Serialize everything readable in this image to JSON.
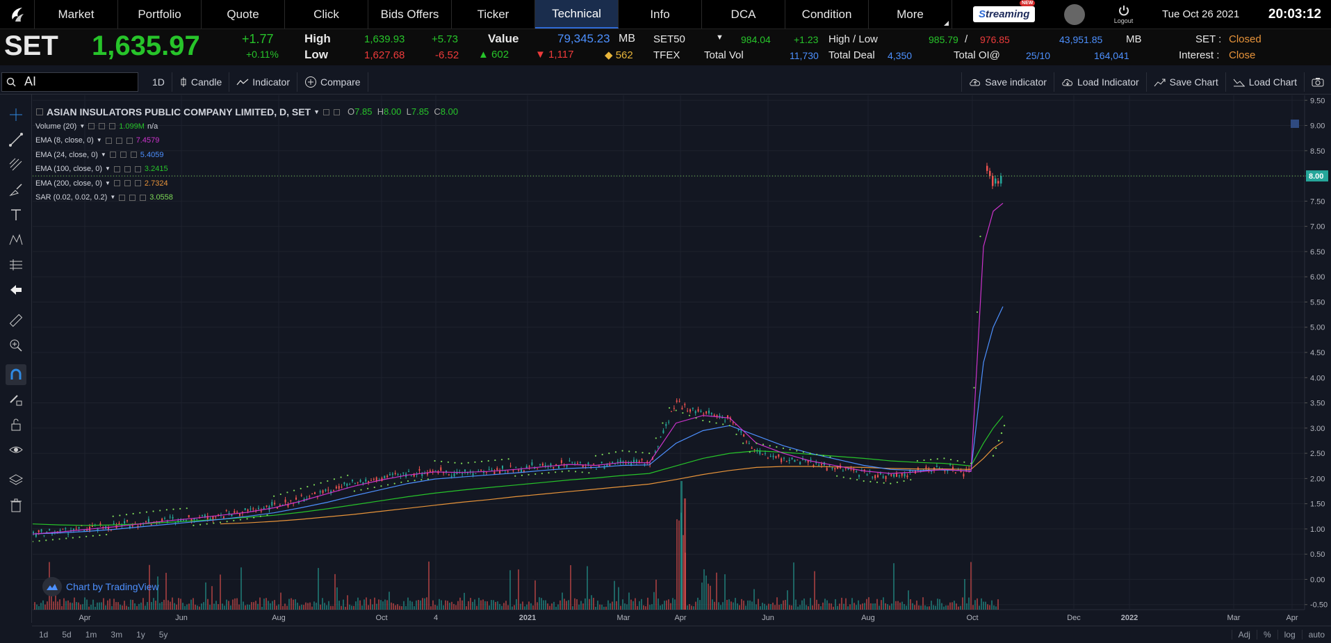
{
  "nav": {
    "tabs": [
      "Market",
      "Portfolio",
      "Quote",
      "Click",
      "Bids Offers",
      "Ticker",
      "Technical",
      "Info",
      "DCA",
      "Condition",
      "More"
    ],
    "active": "Technical",
    "brand": "treaming",
    "brand_badge": "NEW",
    "logout_label": "Logout",
    "date": "Tue Oct 26 2021",
    "time": "20:03:12"
  },
  "ticker": {
    "symbol": "SET",
    "price": "1,635.97",
    "change": "+1.77",
    "change_pct": "+0.11%",
    "high_label": "High",
    "high": "1,639.93",
    "high_chg": "+5.73",
    "low_label": "Low",
    "low": "1,627.68",
    "low_chg": "-6.52",
    "value_label": "Value",
    "value": "79,345.23",
    "value_unit": "MB",
    "up_count": "602",
    "down_count": "1,117",
    "unch_count": "562",
    "set50_label": "SET50",
    "set50": "984.04",
    "set50_chg": "+1.23",
    "hl_label": "High / Low",
    "set50_high": "985.79",
    "hl_sep": "/",
    "set50_low": "976.85",
    "set50_value": "43,951.85",
    "set50_unit": "MB",
    "set_status_label": "SET :",
    "set_status": "Closed",
    "tfex_label": "TFEX",
    "totalvol_label": "Total Vol",
    "totalvol": "11,730",
    "totaldeal_label": "Total Deal",
    "totaldeal": "4,350",
    "totaloi_label": "Total OI@",
    "totaloi_date": "25/10",
    "totaloi": "164,041",
    "interest_label": "Interest :",
    "interest": "Close"
  },
  "toolbar": {
    "search_value": "AI",
    "interval": "1D",
    "candle": "Candle",
    "indicator": "Indicator",
    "compare": "Compare",
    "save_indicator": "Save indicator",
    "load_indicator": "Load Indicator",
    "save_chart": "Save Chart",
    "load_chart": "Load Chart"
  },
  "legend": {
    "title": "ASIAN INSULATORS PUBLIC COMPANY LIMITED, D, SET",
    "o_label": "O",
    "o": "7.85",
    "h_label": "H",
    "h": "8.00",
    "l_label": "L",
    "l": "7.85",
    "c_label": "C",
    "c": "8.00",
    "volume_label": "Volume (20)",
    "volume_value": "1.099M",
    "volume_extra": "n/a",
    "ema8_label": "EMA (8, close, 0)",
    "ema8": "7.4579",
    "ema24_label": "EMA (24, close, 0)",
    "ema24": "5.4059",
    "ema100_label": "EMA (100, close, 0)",
    "ema100": "3.2415",
    "ema200_label": "EMA (200, close, 0)",
    "ema200": "2.7324",
    "sar_label": "SAR (0.02, 0.02, 0.2)",
    "sar": "3.0558"
  },
  "colors": {
    "ema8": "#cc33cc",
    "ema24": "#4d90fe",
    "ema100": "#27c42a",
    "ema200": "#e8943a",
    "sar": "#7ed957",
    "up": "#26a69a",
    "down": "#ef5350"
  },
  "chart_data": {
    "type": "candlestick",
    "y_ticks": [
      "9.50",
      "9.00",
      "8.50",
      "8.00",
      "7.50",
      "7.00",
      "6.50",
      "6.00",
      "5.50",
      "5.00",
      "4.50",
      "4.00",
      "3.50",
      "3.00",
      "2.50",
      "2.00",
      "1.50",
      "1.00",
      "0.50",
      "0.00",
      "-0.50"
    ],
    "ylim": [
      -0.6,
      9.6
    ],
    "x_ticks": [
      "Apr",
      "Jun",
      "Aug",
      "Oct",
      "4",
      "2021",
      "Mar",
      "Apr",
      "Jun",
      "Aug",
      "Oct",
      "Dec",
      "2022",
      "Mar",
      "Apr"
    ],
    "last_price": "8.00",
    "close_series": [
      0.9,
      0.95,
      1.0,
      1.05,
      1.12,
      1.18,
      1.22,
      1.28,
      1.35,
      1.45,
      1.6,
      1.75,
      1.9,
      2.0,
      2.1,
      2.15,
      2.1,
      2.15,
      2.2,
      2.25,
      2.3,
      2.25,
      2.35,
      2.3,
      3.5,
      3.3,
      3.2,
      2.5,
      2.4,
      2.3,
      2.2,
      2.1,
      2.05,
      2.15,
      2.2,
      2.1,
      8.1,
      7.9,
      8.0
    ],
    "ema8_series": [
      0.9,
      0.94,
      0.99,
      1.04,
      1.1,
      1.16,
      1.21,
      1.27,
      1.33,
      1.42,
      1.55,
      1.7,
      1.85,
      1.97,
      2.07,
      2.13,
      2.12,
      2.14,
      2.18,
      2.23,
      2.28,
      2.26,
      2.32,
      2.31,
      3.1,
      3.25,
      3.2,
      2.7,
      2.5,
      2.35,
      2.25,
      2.15,
      2.1,
      2.13,
      2.18,
      2.14,
      6.6,
      7.3,
      7.46
    ],
    "ema24_series": [
      0.9,
      0.92,
      0.95,
      0.99,
      1.04,
      1.09,
      1.14,
      1.19,
      1.25,
      1.32,
      1.42,
      1.53,
      1.66,
      1.78,
      1.9,
      1.99,
      2.03,
      2.07,
      2.11,
      2.16,
      2.2,
      2.22,
      2.26,
      2.27,
      2.7,
      2.95,
      3.05,
      2.85,
      2.65,
      2.5,
      2.38,
      2.26,
      2.18,
      2.16,
      2.17,
      2.15,
      4.3,
      5.0,
      5.41
    ],
    "ema100_series": [
      1.1,
      1.08,
      1.07,
      1.08,
      1.1,
      1.13,
      1.16,
      1.19,
      1.23,
      1.27,
      1.33,
      1.4,
      1.48,
      1.56,
      1.64,
      1.71,
      1.77,
      1.82,
      1.87,
      1.92,
      1.97,
      2.01,
      2.06,
      2.1,
      2.25,
      2.4,
      2.5,
      2.55,
      2.52,
      2.48,
      2.44,
      2.4,
      2.35,
      2.32,
      2.3,
      2.25,
      2.7,
      3.0,
      3.24
    ],
    "ema200_series": [
      null,
      null,
      null,
      null,
      null,
      null,
      null,
      1.1,
      1.12,
      1.15,
      1.19,
      1.24,
      1.29,
      1.35,
      1.41,
      1.47,
      1.53,
      1.58,
      1.64,
      1.69,
      1.74,
      1.79,
      1.84,
      1.89,
      1.98,
      2.08,
      2.16,
      2.22,
      2.24,
      2.24,
      2.23,
      2.22,
      2.2,
      2.19,
      2.19,
      2.18,
      2.4,
      2.6,
      2.73
    ],
    "sar_last": 3.0558
  },
  "bottom": {
    "ranges": [
      "1d",
      "5d",
      "1m",
      "3m",
      "1y",
      "5y"
    ],
    "right": [
      "Adj",
      "%",
      "log",
      "auto"
    ]
  },
  "badge": {
    "tradingview": "Chart by TradingView"
  }
}
